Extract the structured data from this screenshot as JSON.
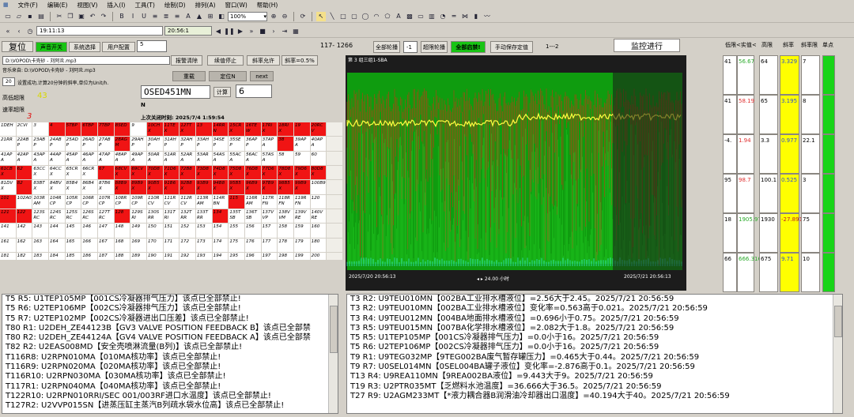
{
  "menu": [
    "文件(F)",
    "编辑(E)",
    "视图(V)",
    "插入(I)",
    "工具(T)",
    "绘制(D)",
    "排列(A)",
    "窗口(W)",
    "帮助(H)"
  ],
  "toolbar": {
    "zoom": "100%",
    "time_left": "19:11:13",
    "time_mid": "20:56:1"
  },
  "top_panel": {
    "reset_label": "复位",
    "sound_switch": "声音开关",
    "system_select": "系统选择",
    "user_config": "用户配置",
    "counter_box": "5",
    "sound_path": "D:\\VOPOD\\卡壳砂 - 刘阿炎.mp3",
    "play_path": "音乐来自: D:\\VOPOD\\卡壳砂 - 刘阿炎.mp3",
    "alarm_clear": "报警清除",
    "continue_stop": "续值停止",
    "slope_allow": "斜率允许",
    "slope_val": "斜率=0.5%",
    "interval_box": "20",
    "interval_text": "设置成功,计算20分钟的斜率,单位为Unit/h.",
    "reset_btn2": "重载",
    "locate_btn": "定位N",
    "next_btn": "next",
    "point_box": "OSED451MN",
    "calc_btn": "计算",
    "calc_result": "6",
    "n_label": "N",
    "high_limit_lbl": "高低超限",
    "high_limit_val": "43",
    "rate_limit_lbl": "速率超限",
    "rate_limit_val": "3",
    "last_close_lbl": "上次关闭时刻: 2025/7/4 1:59:54",
    "counts": "117- 1266",
    "all_overlimit": "全部轮播",
    "minus1": "-1",
    "overlimit_cycle": "超限轮播",
    "all_disable": "全部启禁!",
    "manual_save": "手动保存定值",
    "one_two": "1---2",
    "monitor": "监控进行"
  },
  "grid_cells": [
    [
      "1DEH",
      "2CVI",
      "3",
      "4",
      "5TBP",
      "6TBP",
      "7TBP",
      "8SED",
      "9",
      "10CH X",
      "11TE X",
      "12TT X",
      "13",
      "14RR N",
      "15CR X",
      "16TE W",
      "17RI X",
      "18RI X",
      "19",
      "20RC V"
    ],
    [
      "21RR",
      "22AB P",
      "23AB P",
      "24AB P",
      "25AD P",
      "26AD P",
      "27AB P",
      "28AG M",
      "29AH P",
      "30AH P",
      "31AH P",
      "32AH P",
      "33AH P",
      "34SE P",
      "35SE P",
      "36AP P",
      "37AP A",
      "38",
      "39AP A",
      "40AP A"
    ],
    [
      "41AP A",
      "42AP A",
      "43AP A",
      "44AP A",
      "45AP A",
      "46AP A",
      "47AP A",
      "48AP A",
      "49AP A",
      "50AR A",
      "51AR A",
      "52AR A",
      "53AR A",
      "54AS A",
      "55AC A",
      "56AC A",
      "57AS A",
      "58",
      "59",
      "60"
    ],
    [
      "61CB X",
      "62",
      "63CC X",
      "64CC X",
      "65CR X",
      "66CR X",
      "67",
      "68CV X",
      "69CV X",
      "70D8 X",
      "71D6 X",
      "72B8 X",
      "73D8 X",
      "74D8 X",
      "75D8 X",
      "76D8 X",
      "77D6 X",
      "78D8 X",
      "79D6 X",
      "80D8 X"
    ],
    [
      "81DV X",
      "82",
      "83BT X",
      "84BV X",
      "85B4 X",
      "86B4 X",
      "87B6 X",
      "88B9 X",
      "89B9 X",
      "90B5 X",
      "91B6 X",
      "92B8 X",
      "93B9 X",
      "94B8 X",
      "95B5 X",
      "96B9 X",
      "97B9 X",
      "98B5 X",
      "99B9 X",
      "100B9"
    ],
    [
      "101",
      "102A0",
      "103R AM",
      "104R CP",
      "105R CP",
      "106R CP",
      "107R CP",
      "108R CP",
      "109R CP",
      "110R CV",
      "111R CV",
      "112R CV",
      "113R AM",
      "114R BN",
      "115",
      "116R AM",
      "117R FN",
      "118R FN",
      "119R FN",
      "120"
    ],
    [
      "121",
      "122",
      "123S RC",
      "124S RC",
      "125S RC",
      "126S RC",
      "127T RC",
      "128",
      "129S RI",
      "130S RR",
      "131T RI",
      "132T RR",
      "133T RR",
      "134",
      "135T SB",
      "136T SB",
      "137V VP",
      "138V VM",
      "139V RE",
      "140V RE"
    ],
    [
      "141",
      "142",
      "143",
      "144",
      "145",
      "146",
      "147",
      "148",
      "149",
      "150",
      "151",
      "152",
      "153",
      "154",
      "155",
      "156",
      "157",
      "158",
      "159",
      "160"
    ],
    [
      "161",
      "162",
      "163",
      "164",
      "165",
      "166",
      "167",
      "168",
      "169",
      "170",
      "171",
      "172",
      "173",
      "174",
      "175",
      "176",
      "177",
      "178",
      "179",
      "180"
    ]
  ],
  "grid_red": [
    [
      0,
      3
    ],
    [
      0,
      4
    ],
    [
      0,
      5
    ],
    [
      0,
      6
    ],
    [
      0,
      7
    ],
    [
      0,
      9
    ],
    [
      0,
      10
    ],
    [
      0,
      11
    ],
    [
      0,
      12
    ],
    [
      0,
      13
    ],
    [
      0,
      14
    ],
    [
      0,
      15
    ],
    [
      0,
      16
    ],
    [
      0,
      17
    ],
    [
      0,
      18
    ],
    [
      0,
      19
    ],
    [
      1,
      7
    ],
    [
      1,
      17
    ],
    [
      3,
      0
    ],
    [
      3,
      1
    ],
    [
      3,
      6
    ],
    [
      3,
      7
    ],
    [
      3,
      8
    ],
    [
      3,
      9
    ],
    [
      3,
      10
    ],
    [
      3,
      11
    ],
    [
      3,
      12
    ],
    [
      3,
      13
    ],
    [
      3,
      14
    ],
    [
      3,
      15
    ],
    [
      3,
      16
    ],
    [
      3,
      17
    ],
    [
      3,
      18
    ],
    [
      3,
      19
    ],
    [
      4,
      1
    ],
    [
      4,
      7
    ],
    [
      4,
      8
    ],
    [
      4,
      9
    ],
    [
      4,
      10
    ],
    [
      4,
      11
    ],
    [
      4,
      12
    ],
    [
      4,
      13
    ],
    [
      4,
      14
    ],
    [
      4,
      15
    ],
    [
      4,
      16
    ],
    [
      4,
      17
    ],
    [
      4,
      18
    ],
    [
      5,
      0
    ],
    [
      5,
      14
    ],
    [
      6,
      0
    ],
    [
      6,
      1
    ],
    [
      6,
      7
    ],
    [
      6,
      13
    ]
  ],
  "grid_extra": [
    "181",
    "182",
    "183",
    "184",
    "185",
    "186",
    "187",
    "188",
    "189",
    "190",
    "191",
    "192",
    "193",
    "194",
    "195",
    "196",
    "197",
    "198",
    "199",
    "200"
  ],
  "chart": {
    "title": "第 3 组三组1-SBA",
    "time_start": "2025/7/20 20:56:13",
    "time_end": "2025/7/21 20:56:13",
    "span": "24.00 小时"
  },
  "right_panel": {
    "headers": [
      "低限<实值<",
      "高限",
      "斜率",
      "斜率限",
      "单点"
    ],
    "rows": [
      {
        "low": "41",
        "val": "56.67",
        "high": "64",
        "slope": "3.329",
        "slim": "7"
      },
      {
        "low": "41",
        "val": "58.19",
        "high": "65",
        "slope": "3.195",
        "slim": "8"
      },
      {
        "low": "-4.",
        "val": "1.94",
        "high": "3.3",
        "slope": "0.977",
        "slim": "22.1"
      },
      {
        "low": "95",
        "val": "98.7",
        "high": "100.1",
        "slope": "0.525",
        "slim": "3"
      },
      {
        "low": "18",
        "val": "1905.979",
        "high": "1930",
        "slope": "-27.891",
        "slim": "75"
      },
      {
        "low": "66",
        "val": "666.316",
        "high": "675",
        "slope": "9.71",
        "slim": "10"
      }
    ]
  },
  "left_log": [
    "T5  R5:  U1TEP105MP【001CS冷凝器排气压力】该点已全部禁止!",
    "T5  R6:  U2TEP106MP【002CS冷凝器排气压力】该点已全部禁止!",
    "T5  R7:  U2TEP102MP【002CS冷凝器进出口压差】该点已全部禁止!",
    "T80 R1:  U2DEH_ZE44123B【GV3 VALVE POSITION FEEDBACK B】该点已全部禁",
    "T80 R2:  U2DEH_ZE44124A【GV4 VALVE POSITION FEEDBACK A】该点已全部禁",
    "T82 R2:  U2EAS008MD【安全壳喷淋流量(B列)】该点已全部禁止!",
    "T116R8:  U2RPN010MA【010MA核功率】该点已全部禁止!",
    "T116R9:  U2RPN020MA【020MA核功率】该点已全部禁止!",
    "T116R10: U2RPN030MA【030MA核功率】该点已全部禁止!",
    "T117R1:  U2RPN040MA【040MA核功率】该点已全部禁止!",
    "T122R10: U2RPN010RRI/SEC 001/003RF进口水温度】该点已全部禁止!",
    "T127R2:  U2VVP015SN【进蒸压缸主蒸汽B列疏水袋水位高】该点已全部禁止!"
  ],
  "right_log": [
    "T3  R2:  U9TEU010MN【002BA工业排水槽液位】=2.56大于2.45。2025/7/21 20:56:59",
    "T3  R2:  U9TEU010MN【002BA工业排水槽液位】变化率=0.563高于0.021。2025/7/21 20:56:59",
    "T3  R4:  U9TEU012MN【004BA地面排水槽液位】=0.696小于0.75。2025/7/21 20:56:59",
    "T3  R5:  U9TEU015MN【007BA化学排水槽液位】=2.082大于1.8。2025/7/21 20:56:59",
    "T5  R5:  U1TEP105MP【001CS冷凝器排气压力】=0.0小于16。2025/7/21 20:56:59",
    "T5  R6:  U2TEP106MP【002CS冷凝器排气压力】=0.0小于16。2025/7/21 20:56:59",
    "T9  R1:  U9TEG032MP【9TEG002BA废气暂存罐压力】=0.465大于0.44。2025/7/21 20:56:59",
    "T9  R7:  U0SEL014MN【0SEL004BA罐子液位】变化率=-2.876高于0.1。2025/7/21 20:56:59",
    "T13 R4:  U9REA110MN【9REA002BA液位】=9.443大于9。2025/7/21 20:56:59",
    "T19 R3:  U2PTR035MT【乏燃料水池温度】=36.666大于36.5。2025/7/21 20:56:59",
    "T27 R9:  U2AGM233MT【*液力耦合器B润滑油冷却器出口温度】=40.194大于40。2025/7/21 20:56:59"
  ]
}
